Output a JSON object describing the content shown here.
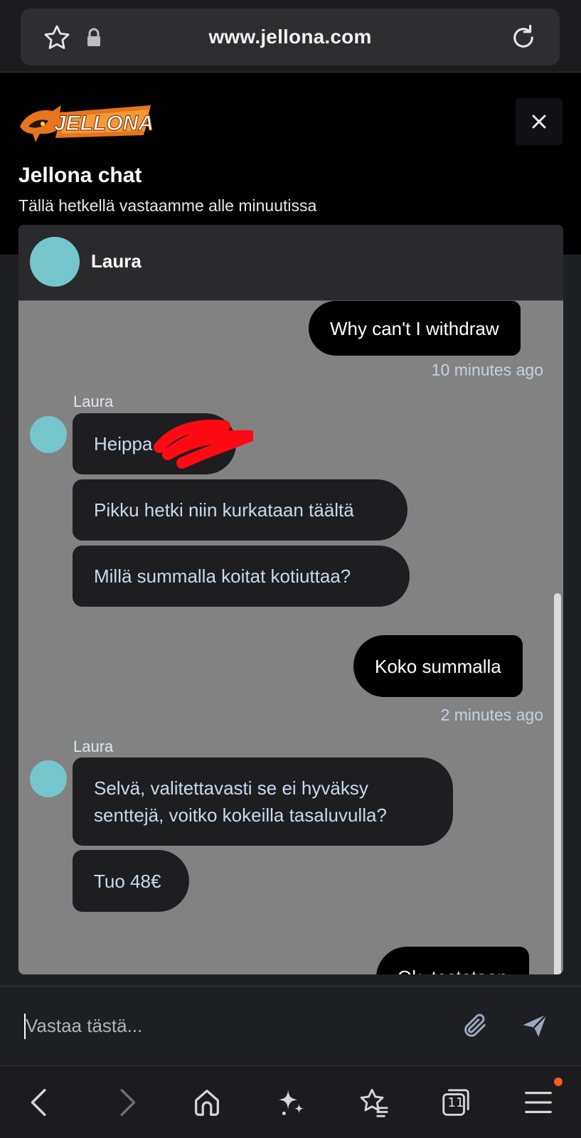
{
  "browser": {
    "url": "www.jellona.com",
    "tab_count": "11"
  },
  "chat": {
    "logo_text": "JELLONA",
    "title": "Jellona chat",
    "subtitle": "Tällä hetkellä vastaamme alle minuutissa",
    "agent_name": "Laura",
    "input_placeholder": "Vastaa tästä..."
  },
  "messages": {
    "m1": "Why can't I withdraw",
    "t1": "10 minutes ago",
    "sender1": "Laura",
    "m2": "Heippa",
    "m3": "Pikku hetki niin kurkataan täältä",
    "m4": "Millä summalla koitat kotiuttaa?",
    "m5": "Koko summalla",
    "t2": "2 minutes ago",
    "sender2": "Laura",
    "m6_line1": "Selvä, valitettavasti se ei hyväksy",
    "m6_line2": "senttejä, voitko kokeilla tasaluvulla?",
    "m7": "Tuo 48€",
    "m8": "Ok, testataan"
  },
  "colors": {
    "panel_bg": "#828282",
    "agent_avatar": "#74c6cc",
    "outgoing_bubble": "#000000",
    "incoming_bubble": "#1e1e20",
    "logo_orange": "#f07a1e",
    "notification_dot": "#ff5a1f"
  }
}
